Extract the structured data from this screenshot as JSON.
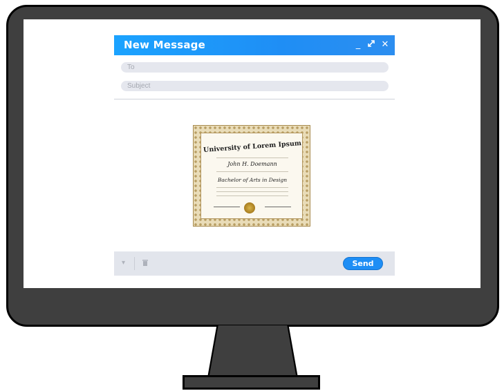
{
  "compose": {
    "title": "New Message",
    "controls": {
      "minimize_icon": "minimize-icon",
      "expand_icon": "expand-icon",
      "close_icon": "close-icon"
    },
    "to_placeholder": "To",
    "subject_placeholder": "Subject",
    "send_label": "Send"
  },
  "attachment": {
    "type": "certificate-image",
    "university": "University of Lorem Ipsum",
    "recipient": "John H. Doemann",
    "degree": "Bachelor of Arts in Design"
  },
  "colors": {
    "titlebar": "#1ba3ff",
    "send_button": "#1e8ef5",
    "monitor_body": "#3f3f3f",
    "field_bg": "#e5e7ee"
  }
}
